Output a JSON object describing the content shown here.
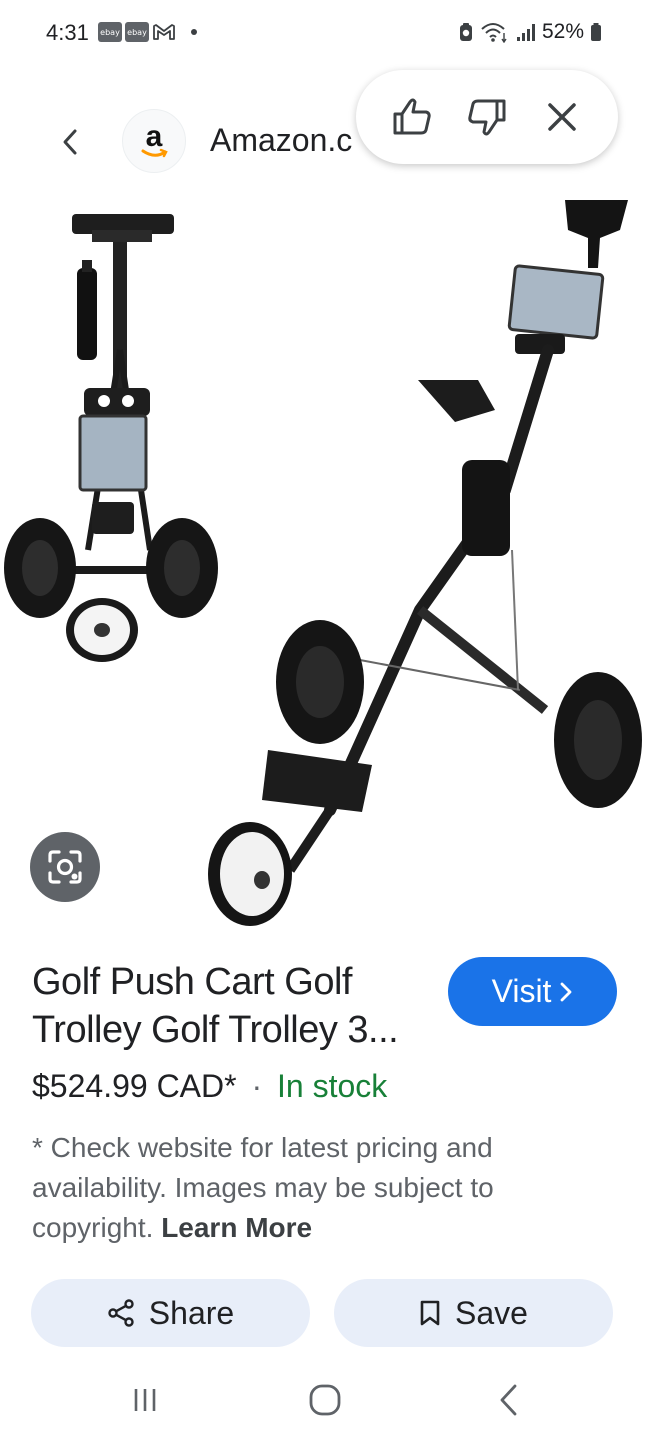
{
  "status_bar": {
    "time": "4:31",
    "notifications": [
      "ebay",
      "ebay"
    ],
    "battery": "52%"
  },
  "header": {
    "site_name": "Amazon.c",
    "favicon_letter": "a"
  },
  "product": {
    "title": "Golf Push Cart Golf Trolley Golf Trolley 3...",
    "visit_label": "Visit",
    "price": "$524.99 CAD*",
    "separator": "·",
    "stock": "In stock",
    "disclaimer_text": "* Check website for latest pricing and availability. Images may be subject to copyright.",
    "learn_more": "Learn More"
  },
  "actions": {
    "share_label": "Share",
    "save_label": "Save"
  },
  "icons": {
    "back": "chevron-left-icon",
    "thumbs_up": "thumbs-up-icon",
    "thumbs_down": "thumbs-down-icon",
    "close": "close-icon",
    "lens": "lens-icon"
  },
  "colors": {
    "accent": "#1a73e8",
    "in_stock": "#188038",
    "action_bg": "#e8eef9",
    "lens_bg": "#5f6368"
  }
}
